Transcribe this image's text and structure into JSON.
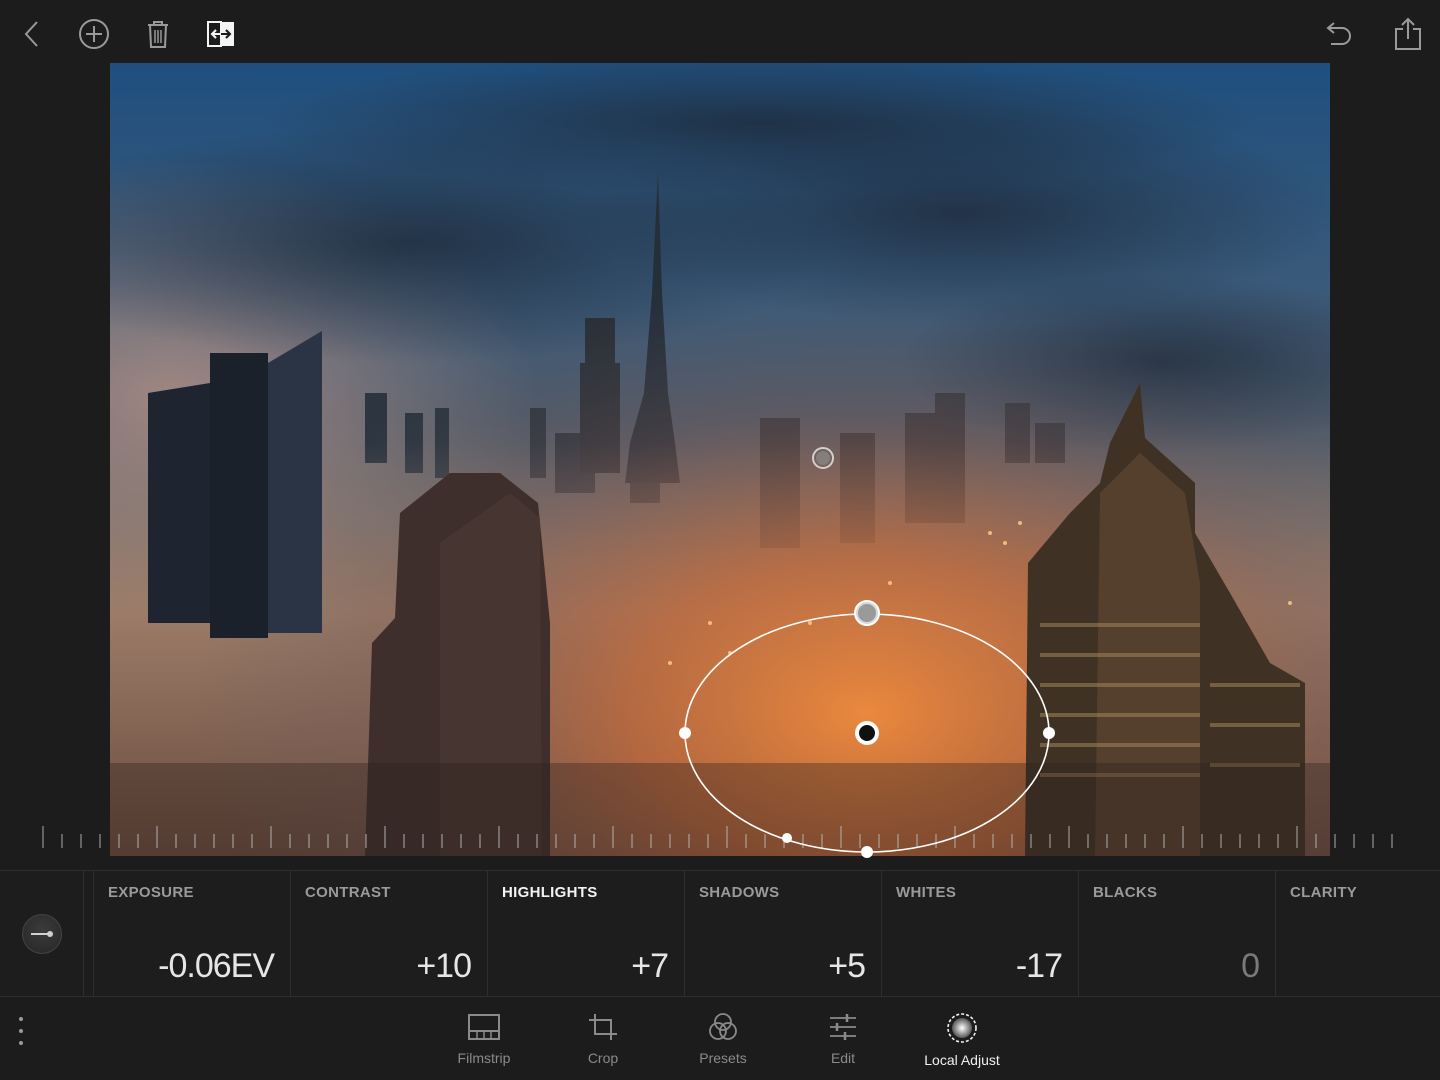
{
  "toolbar": {
    "left_icons": [
      "back-chevron-icon",
      "add-circle-icon",
      "trash-icon",
      "before-after-compare-icon"
    ],
    "right_icons": [
      "undo-icon",
      "share-icon"
    ]
  },
  "adjustments": [
    {
      "label": "EXPOSURE",
      "value": "-0.06EV",
      "active": false
    },
    {
      "label": "CONTRAST",
      "value": "+10",
      "active": false
    },
    {
      "label": "HIGHLIGHTS",
      "value": "+7",
      "active": true
    },
    {
      "label": "SHADOWS",
      "value": "+5",
      "active": false
    },
    {
      "label": "WHITES",
      "value": "-17",
      "active": false
    },
    {
      "label": "BLACKS",
      "value": "0",
      "active": false
    },
    {
      "label": "CLARITY",
      "value": "",
      "active": false
    }
  ],
  "tabs": [
    {
      "label": "Filmstrip",
      "icon": "filmstrip-icon",
      "active": false
    },
    {
      "label": "Crop",
      "icon": "crop-icon",
      "active": false
    },
    {
      "label": "Presets",
      "icon": "presets-icon",
      "active": false
    },
    {
      "label": "Edit",
      "icon": "edit-sliders-icon",
      "active": false
    },
    {
      "label": "Local Adjust",
      "icon": "local-adjust-icon",
      "active": true
    }
  ],
  "colors": {
    "background": "#1c1c1c",
    "active_text": "#f2f2f2",
    "inactive_text": "#9a9a9a",
    "mask_line": "#ffffff"
  }
}
